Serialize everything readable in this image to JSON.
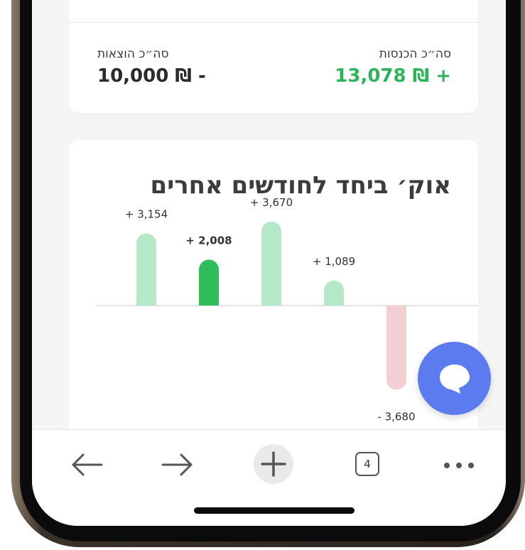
{
  "totals": {
    "income_label": "סה״כ הכנסות",
    "income_value": "13,078 ₪ +",
    "expense_label": "סה״כ הוצאות",
    "expense_value": "10,000 ₪ -"
  },
  "chart_card": {
    "title": "אוק׳ ביחד לחודשים אחרים"
  },
  "chart_data": {
    "type": "bar",
    "title": "אוק׳ ביחד לחודשים אחרים",
    "values": [
      3154,
      2008,
      3670,
      1089,
      -3680
    ],
    "labels": [
      "+ 3,154",
      "+ 2,008",
      "+ 3,670",
      "+ 1,089",
      "- 3,680"
    ],
    "highlighted_index": 1,
    "colors": {
      "positive": "#b4e8c6",
      "highlight": "#2fbd5b",
      "negative": "#f2cfd3",
      "baseline": "#c8c8cc"
    }
  },
  "bottom_nav": {
    "back_icon": "arrow-left-icon",
    "forward_icon": "arrow-right-icon",
    "new_tab_icon": "plus-icon",
    "tab_count": "4",
    "menu_icon": "more-dots-icon"
  },
  "chat_button": {
    "icon": "chat-bubble-icon",
    "color": "#5b7bef"
  }
}
